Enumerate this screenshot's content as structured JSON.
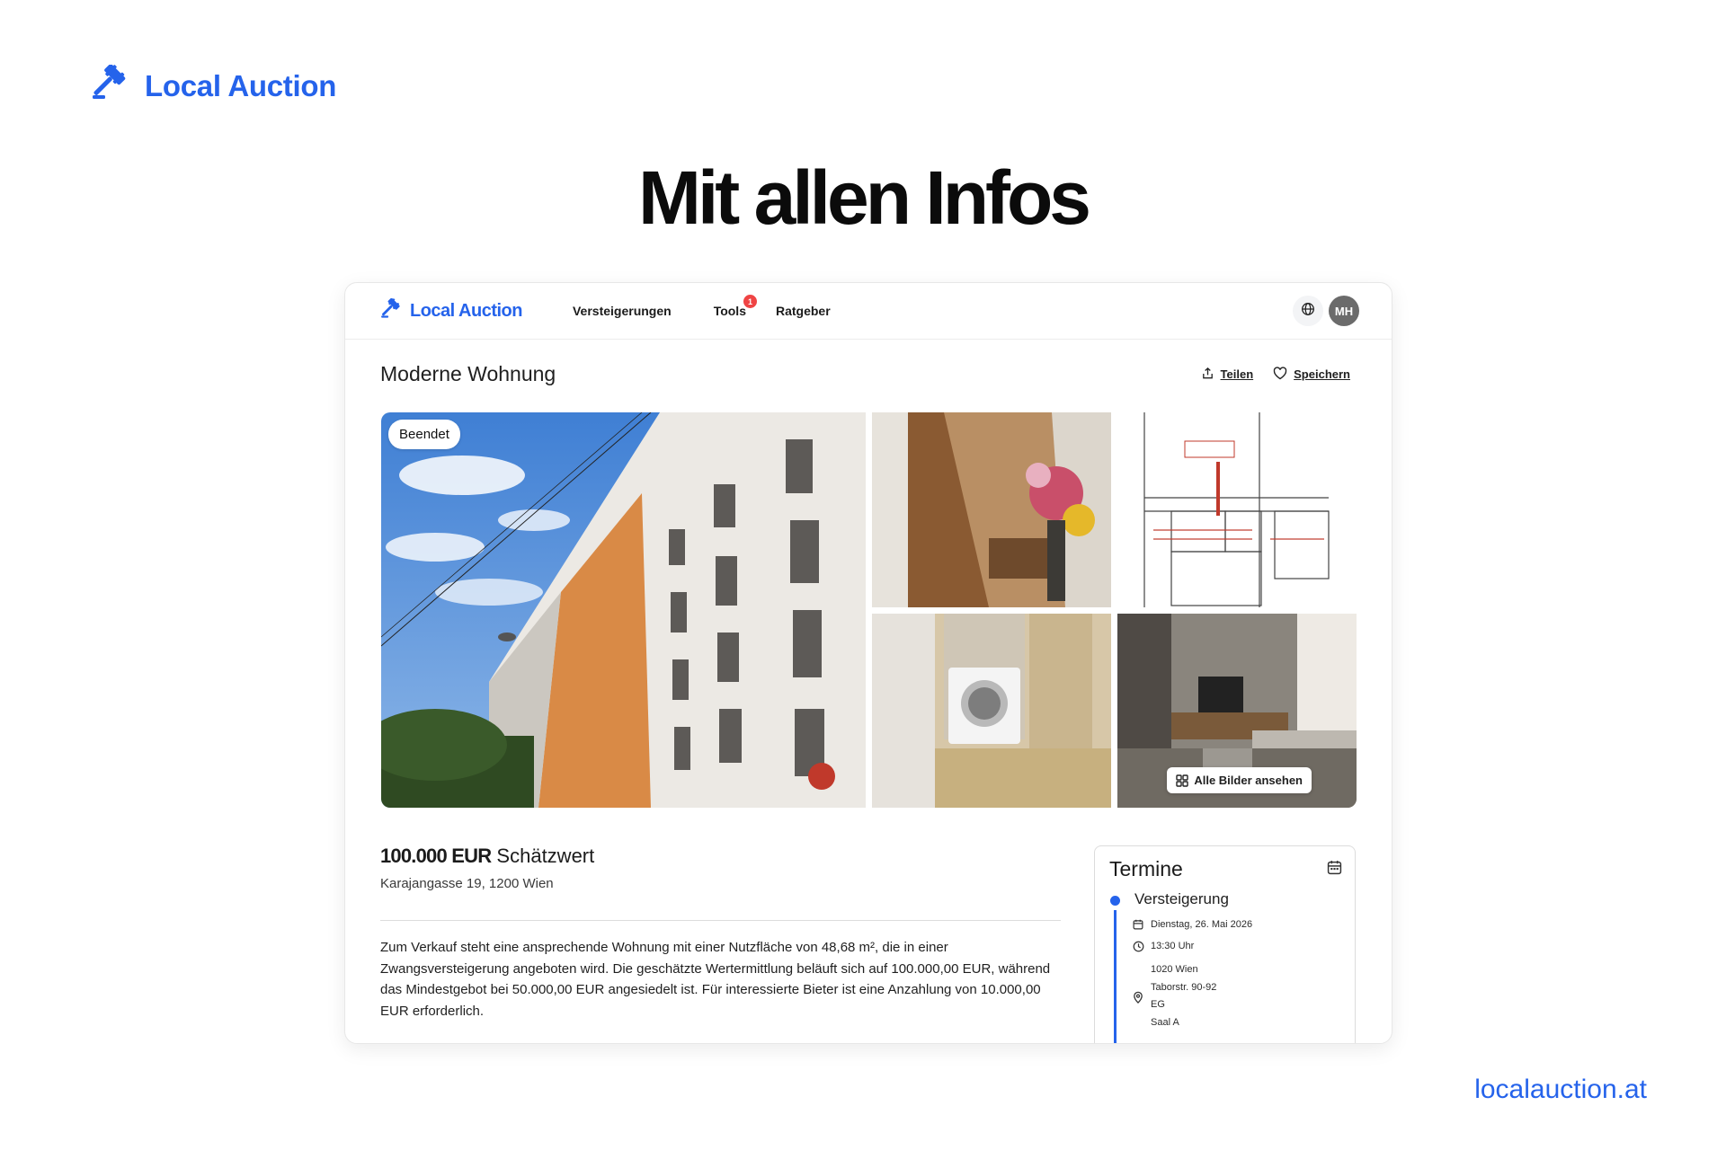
{
  "brand": {
    "name": "Local Auction",
    "color": "#2563eb",
    "icon": "gavel-icon"
  },
  "hero": {
    "title": "Mit allen Infos"
  },
  "footer": {
    "url": "localauction.at"
  },
  "app": {
    "nav": {
      "brand": "Local Auction",
      "links": [
        {
          "label": "Versteigerungen"
        },
        {
          "label": "Tools",
          "badge": "1"
        },
        {
          "label": "Ratgeber"
        }
      ],
      "language_icon": "globe-icon",
      "avatar_initials": "MH"
    },
    "listing": {
      "title": "Moderne Wohnung",
      "share_label": "Teilen",
      "save_label": "Speichern",
      "status": "Beendet",
      "all_photos_label": "Alle Bilder ansehen",
      "price_amount": "100.000 EUR",
      "price_label": "Schätzwert",
      "address": "Karajangasse 19, 1200 Wien",
      "description": "Zum Verkauf steht eine ansprechende Wohnung mit einer Nutzfläche von 48,68 m², die in einer Zwangsversteigerung angeboten wird. Die geschätzte Wertermittlung beläuft sich auf 100.000,00 EUR, während das Mindestgebot bei 50.000,00 EUR angesiedelt ist. Für interessierte Bieter ist eine Anzahlung von 10.000,00 EUR erforderlich."
    },
    "termine": {
      "title": "Termine",
      "event": {
        "name": "Versteigerung",
        "date": "Dienstag, 26. Mai 2026",
        "time": "13:30 Uhr",
        "address_lines": [
          "1020 Wien",
          "Taborstr. 90-92",
          "EG",
          "Saal A"
        ]
      }
    }
  }
}
